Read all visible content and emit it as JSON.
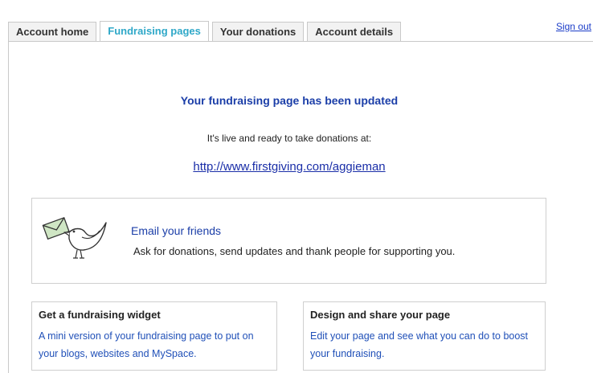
{
  "tabs": [
    {
      "label": "Account home",
      "active": false
    },
    {
      "label": "Fundraising pages",
      "active": true
    },
    {
      "label": "Your donations",
      "active": false
    },
    {
      "label": "Account details",
      "active": false
    }
  ],
  "header": {
    "sign_out": "Sign out"
  },
  "message": {
    "headline": "Your fundraising page has been updated",
    "subline": "It's live and ready to take donations at:",
    "url": "http://www.firstgiving.com/aggieman"
  },
  "email_box": {
    "icon": "bird-with-envelope-icon",
    "title": "Email your friends",
    "description": "Ask for donations, send updates and thank people for supporting you."
  },
  "widget_box": {
    "title": "Get a fundraising widget",
    "description": "A mini version of your fundraising page to put on your blogs, websites and MySpace."
  },
  "design_box": {
    "title": "Design and share your page",
    "description": "Edit your page and see what you can do to boost your fundraising."
  },
  "colors": {
    "active_tab": "#2fa8c8",
    "heading_blue": "#1b3ea8",
    "link_blue": "#2050b8"
  }
}
